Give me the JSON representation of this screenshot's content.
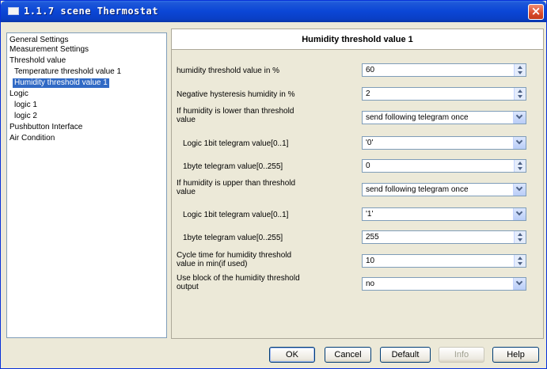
{
  "window": {
    "title": "1.1.7 scene Thermostat",
    "close_symbol": "×"
  },
  "tree": {
    "items": [
      {
        "label": "General Settings",
        "selected": false
      },
      {
        "label": "Measurement Settings",
        "selected": false
      },
      {
        "label": "Threshold value",
        "selected": false
      },
      {
        "label": "Temperature threshold value 1",
        "selected": false
      },
      {
        "label": "Humidity threshold value 1",
        "selected": true
      },
      {
        "label": "Logic",
        "selected": false
      },
      {
        "label": "logic 1",
        "selected": false
      },
      {
        "label": "logic 2",
        "selected": false
      },
      {
        "label": "Pushbutton Interface",
        "selected": false
      },
      {
        "label": "Air Condition",
        "selected": false
      }
    ]
  },
  "panel": {
    "title": "Humidity threshold value 1",
    "params": [
      {
        "label": "humidity threshold value in %",
        "value": "60",
        "control": "spin"
      },
      {
        "label": "Negative hysteresis humidity in %",
        "value": "2",
        "control": "spin"
      },
      {
        "label": "If humidity is lower than threshold value",
        "value": "send following telegram once",
        "control": "dropdown"
      },
      {
        "label": "Logic 1bit telegram value[0..1]",
        "value": "'0'",
        "control": "dropdown"
      },
      {
        "label": "1byte telegram value[0..255]",
        "value": "0",
        "control": "spin"
      },
      {
        "label": "If humidity is upper than threshold value",
        "value": "send following telegram once",
        "control": "dropdown"
      },
      {
        "label": "Logic 1bit telegram value[0..1]",
        "value": "'1'",
        "control": "dropdown"
      },
      {
        "label": "1byte telegram value[0..255]",
        "value": "255",
        "control": "spin"
      },
      {
        "label": "Cycle time for humidity threshold value in min(if used)",
        "value": "10",
        "control": "spin"
      },
      {
        "label": "Use block of the humidity threshold output",
        "value": "no",
        "control": "dropdown"
      }
    ]
  },
  "buttons": {
    "ok": "OK",
    "cancel": "Cancel",
    "default": "Default",
    "info": "Info",
    "help": "Help"
  },
  "colors": {
    "titlebar": "#0b46d6",
    "selection": "#316ac5",
    "dialog_bg": "#ece9d8",
    "close": "#d94a2a"
  }
}
